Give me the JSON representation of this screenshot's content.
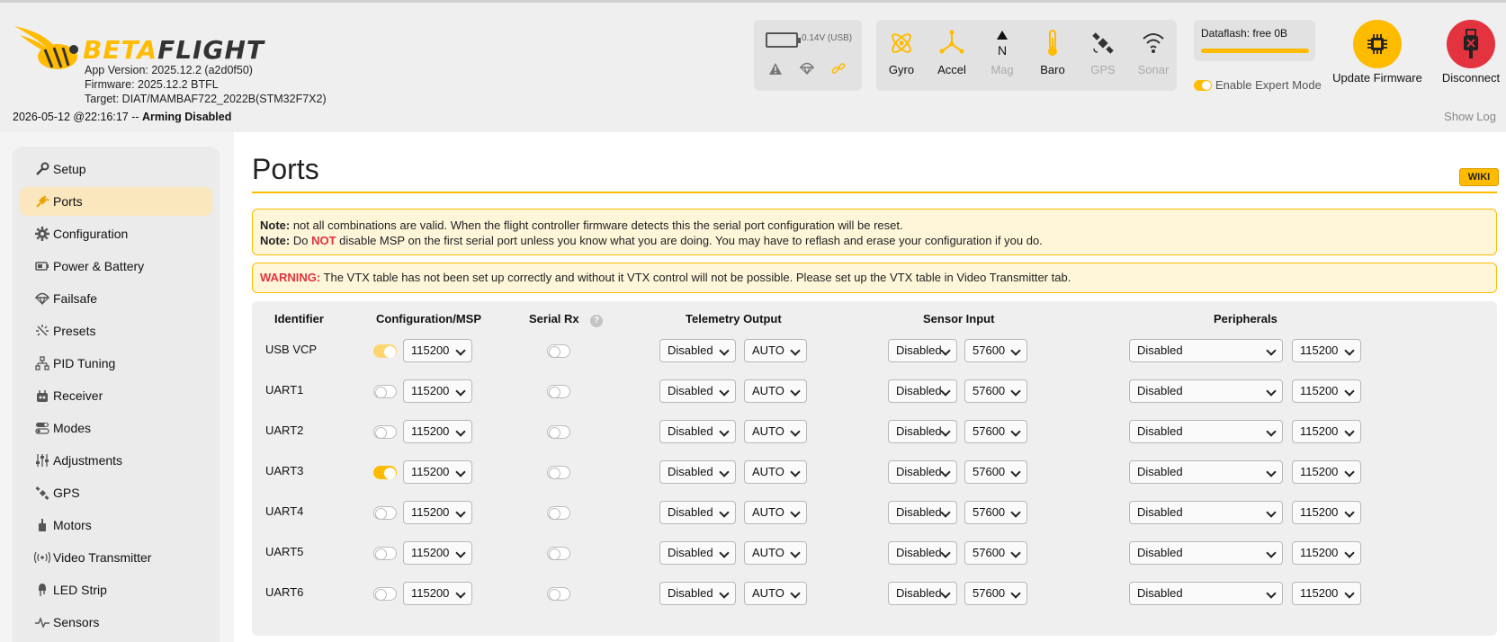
{
  "header": {
    "logo_beta": "BETA",
    "logo_flight": "FLIGHT",
    "app_version": "App Version: 2025.12.2 (a2d0f50)",
    "firmware": "Firmware: 2025.12.2 BTFL",
    "target": "Target: DIAT/MAMBAF722_2022B(STM32F7X2)",
    "timestamp": "2026-05-12 @22:16:17 -- ",
    "arming_status": "Arming Disabled",
    "show_log": "Show Log",
    "battery": "0.14V (USB)",
    "sensors": [
      {
        "label": "Gyro",
        "icon": "gyro-icon",
        "enabled": true
      },
      {
        "label": "Accel",
        "icon": "accel-icon",
        "enabled": true
      },
      {
        "label": "Mag",
        "icon": "mag-icon",
        "enabled": false
      },
      {
        "label": "Baro",
        "icon": "baro-icon",
        "enabled": true
      },
      {
        "label": "GPS",
        "icon": "gps-icon",
        "enabled": false
      },
      {
        "label": "Sonar",
        "icon": "sonar-icon",
        "enabled": false
      }
    ],
    "mag_letter": "N",
    "dataflash": "Dataflash: free 0B",
    "expert_mode": "Enable Expert Mode",
    "update_firmware": "Update Firmware",
    "disconnect": "Disconnect"
  },
  "sidebar": {
    "items": [
      {
        "label": "Setup",
        "icon": "wrench-icon"
      },
      {
        "label": "Ports",
        "icon": "plug-icon",
        "active": true
      },
      {
        "label": "Configuration",
        "icon": "gear-icon"
      },
      {
        "label": "Power & Battery",
        "icon": "battery-icon"
      },
      {
        "label": "Failsafe",
        "icon": "parachute-icon"
      },
      {
        "label": "Presets",
        "icon": "sparkle-icon"
      },
      {
        "label": "PID Tuning",
        "icon": "pid-tree-icon"
      },
      {
        "label": "Receiver",
        "icon": "receiver-icon"
      },
      {
        "label": "Modes",
        "icon": "toggles-icon"
      },
      {
        "label": "Adjustments",
        "icon": "sliders-icon"
      },
      {
        "label": "GPS",
        "icon": "satellite-icon"
      },
      {
        "label": "Motors",
        "icon": "motor-icon"
      },
      {
        "label": "Video Transmitter",
        "icon": "broadcast-icon"
      },
      {
        "label": "LED Strip",
        "icon": "led-icon"
      },
      {
        "label": "Sensors",
        "icon": "pulse-icon"
      }
    ]
  },
  "main": {
    "title": "Ports",
    "wiki": "WIKI",
    "note1_label": "Note:",
    "note1_text": " not all combinations are valid. When the flight controller firmware detects this the serial port configuration will be reset.",
    "note2_label": "Note:",
    "note2_pre": " Do ",
    "note2_not": "NOT",
    "note2_post": " disable MSP on the first serial port unless you know what you are doing. You may have to reflash and erase your configuration if you do.",
    "warning_label": "WARNING:",
    "warning_text": " The VTX table has not been set up correctly and without it VTX control will not be possible. Please set up the VTX table in Video Transmitter tab.",
    "columns": [
      "Identifier",
      "Configuration/MSP",
      "Serial Rx",
      "Telemetry Output",
      "Sensor Input",
      "Peripherals"
    ],
    "help_glyph": "?",
    "rows": [
      {
        "id": "USB VCP",
        "msp": "half",
        "msp_baud": "115200",
        "serial_rx": false,
        "telemetry": "Disabled",
        "telemetry_baud": "AUTO",
        "sensor": "Disabled",
        "sensor_baud": "57600",
        "peripheral": "Disabled",
        "peripheral_baud": "115200"
      },
      {
        "id": "UART1",
        "msp": "off",
        "msp_baud": "115200",
        "serial_rx": false,
        "telemetry": "Disabled",
        "telemetry_baud": "AUTO",
        "sensor": "Disabled",
        "sensor_baud": "57600",
        "peripheral": "Disabled",
        "peripheral_baud": "115200"
      },
      {
        "id": "UART2",
        "msp": "off",
        "msp_baud": "115200",
        "serial_rx": false,
        "telemetry": "Disabled",
        "telemetry_baud": "AUTO",
        "sensor": "Disabled",
        "sensor_baud": "57600",
        "peripheral": "Disabled",
        "peripheral_baud": "115200"
      },
      {
        "id": "UART3",
        "msp": "on",
        "msp_baud": "115200",
        "serial_rx": false,
        "telemetry": "Disabled",
        "telemetry_baud": "AUTO",
        "sensor": "Disabled",
        "sensor_baud": "57600",
        "peripheral": "Disabled",
        "peripheral_baud": "115200"
      },
      {
        "id": "UART4",
        "msp": "off",
        "msp_baud": "115200",
        "serial_rx": false,
        "telemetry": "Disabled",
        "telemetry_baud": "AUTO",
        "sensor": "Disabled",
        "sensor_baud": "57600",
        "peripheral": "Disabled",
        "peripheral_baud": "115200"
      },
      {
        "id": "UART5",
        "msp": "off",
        "msp_baud": "115200",
        "serial_rx": false,
        "telemetry": "Disabled",
        "telemetry_baud": "AUTO",
        "sensor": "Disabled",
        "sensor_baud": "57600",
        "peripheral": "Disabled",
        "peripheral_baud": "115200"
      },
      {
        "id": "UART6",
        "msp": "off",
        "msp_baud": "115200",
        "serial_rx": false,
        "telemetry": "Disabled",
        "telemetry_baud": "AUTO",
        "sensor": "Disabled",
        "sensor_baud": "57600",
        "peripheral": "Disabled",
        "peripheral_baud": "115200"
      }
    ]
  },
  "colors": {
    "accent": "#ffbb00",
    "danger": "#e2333f",
    "note_bg": "#fff5d9"
  }
}
